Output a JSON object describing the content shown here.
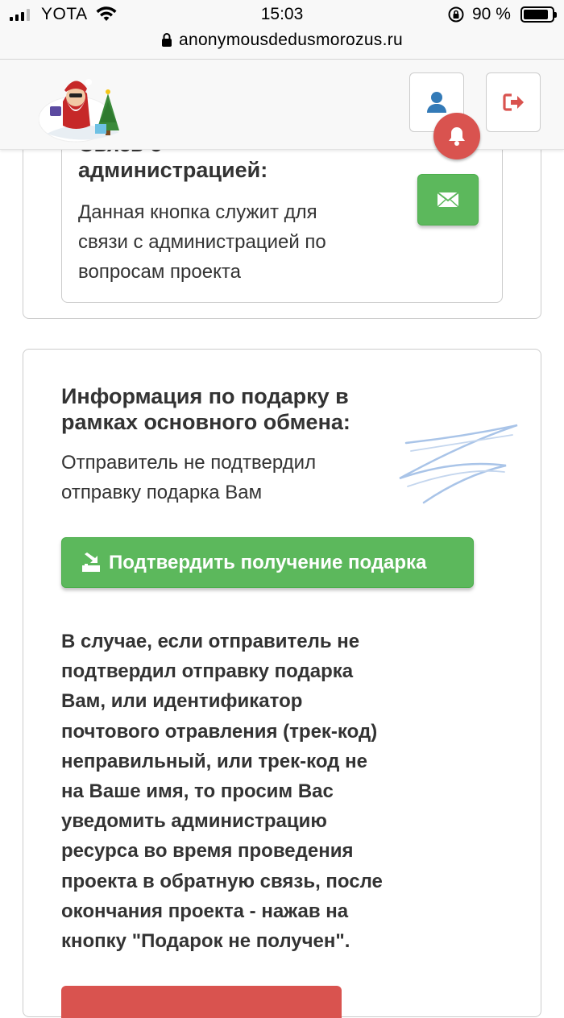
{
  "status_bar": {
    "carrier": "YOTA",
    "time": "15:03",
    "battery": "90 %"
  },
  "url_bar": {
    "url": "anonymousdedusmorozus.ru"
  },
  "icons": {
    "profile": "user-icon",
    "logout": "logout-icon",
    "notifications": "bell-icon",
    "mail": "envelope-icon",
    "confirm": "box-arrow-icon"
  },
  "admin_panel": {
    "title_partial": "Связь с",
    "title": "администрацией:",
    "description_lines": [
      "Данная кнопка служит для",
      "связи с администрацией по",
      "вопросам проекта"
    ]
  },
  "gift_panel": {
    "title_lines": [
      "Информация по подарку в",
      "рамках основного обмена:"
    ],
    "status_lines": [
      "Отправитель не подтвердил",
      "отправку подарка Вам"
    ],
    "confirm_button": "Подтвердить получение подарка",
    "notice_lines": [
      "В случае, если отправитель не",
      "подтвердил отправку подарка",
      "Вам, или идентификатор",
      "почтового отравления (трек-код)",
      "неправильный, или трек-код не",
      "на Ваше имя, то просим Вас",
      "уведомить администрацию",
      "ресурса во время проведения",
      "проекта в обратную связь, после",
      "окончания проекта - нажав на",
      "кнопку \"Подарок не получен\"."
    ]
  },
  "colors": {
    "success": "#5cb85c",
    "danger": "#d9534f",
    "primary": "#337ab7"
  }
}
